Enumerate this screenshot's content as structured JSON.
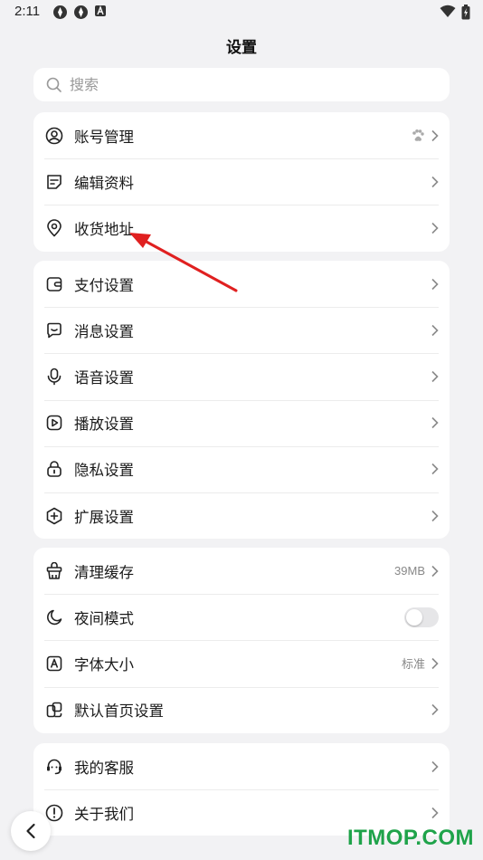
{
  "status_bar": {
    "time": "2:11"
  },
  "header": {
    "title": "设置"
  },
  "search": {
    "placeholder": "搜索"
  },
  "groups": [
    {
      "items": [
        {
          "label": "账号管理",
          "icon": "account-icon",
          "right_icon": "paw-icon"
        },
        {
          "label": "编辑资料",
          "icon": "edit-profile-icon"
        },
        {
          "label": "收货地址",
          "icon": "location-icon"
        }
      ]
    },
    {
      "items": [
        {
          "label": "支付设置",
          "icon": "wallet-icon"
        },
        {
          "label": "消息设置",
          "icon": "message-icon"
        },
        {
          "label": "语音设置",
          "icon": "microphone-icon"
        },
        {
          "label": "播放设置",
          "icon": "play-icon"
        },
        {
          "label": "隐私设置",
          "icon": "lock-icon"
        },
        {
          "label": "扩展设置",
          "icon": "extension-icon"
        }
      ]
    },
    {
      "items": [
        {
          "label": "清理缓存",
          "icon": "clean-icon",
          "value": "39MB"
        },
        {
          "label": "夜间模式",
          "icon": "moon-icon",
          "toggle": false
        },
        {
          "label": "字体大小",
          "icon": "font-icon",
          "value": "标准"
        },
        {
          "label": "默认首页设置",
          "icon": "home-layout-icon"
        }
      ]
    },
    {
      "items": [
        {
          "label": "我的客服",
          "icon": "support-icon"
        },
        {
          "label": "关于我们",
          "icon": "info-icon"
        }
      ]
    }
  ],
  "watermark": "ITMOP.COM",
  "colors": {
    "background": "#f2f2f4",
    "card": "#ffffff",
    "annotation_arrow": "#e02020",
    "watermark": "#1fa34a"
  }
}
